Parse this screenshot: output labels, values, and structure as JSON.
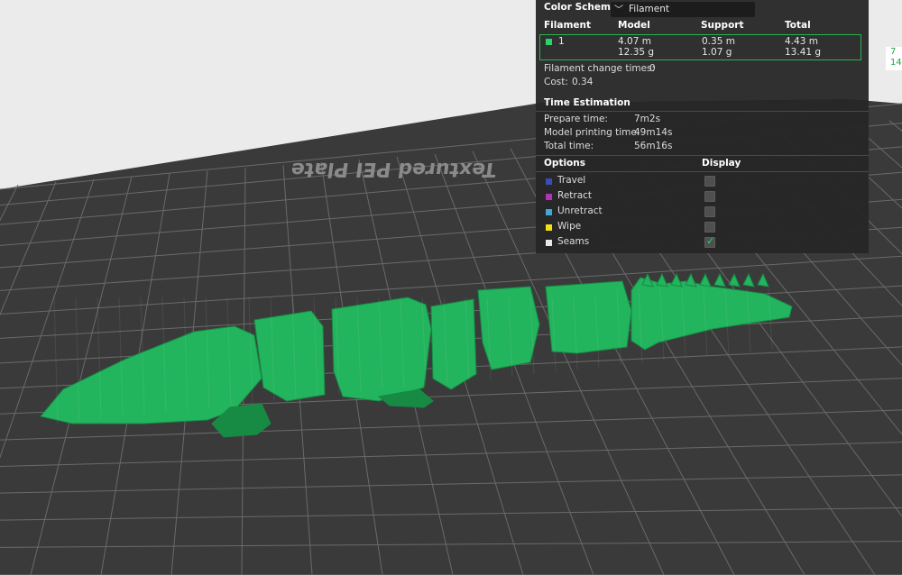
{
  "scene": {
    "plate_label": "Textured PEI Plate",
    "colors": {
      "background": "#ebebeb",
      "plate": "#3a3a3a",
      "grid": "#6a6a6a",
      "model": "#23b45e",
      "model_dark": "#178a44"
    }
  },
  "legend": {
    "color_scheme_label": "Color Scheme",
    "color_scheme_value": "Filament",
    "columns": {
      "filament": "Filament",
      "model": "Model",
      "support": "Support",
      "total": "Total"
    },
    "rows": [
      {
        "id": "1",
        "color": "#2bd46a",
        "model_length": "4.07 m",
        "model_weight": "12.35 g",
        "support_length": "0.35 m",
        "support_weight": "1.07 g",
        "total_length": "4.43 m",
        "total_weight": "13.41 g"
      }
    ],
    "change_times_label": "Filament change times:",
    "change_times_value": "0",
    "cost_label": "Cost:",
    "cost_value": "0.34",
    "time_estimation": {
      "title": "Time Estimation",
      "prepare_label": "Prepare time:",
      "prepare_value": "7m2s",
      "model_label": "Model printing time:",
      "model_value": "49m14s",
      "total_label": "Total time:",
      "total_value": "56m16s"
    },
    "options_header": "Options",
    "display_header": "Display",
    "options": [
      {
        "label": "Travel",
        "color": "#3a4eb2",
        "checked": false
      },
      {
        "label": "Retract",
        "color": "#b52fc1",
        "checked": false
      },
      {
        "label": "Unretract",
        "color": "#3fa8d6",
        "checked": false
      },
      {
        "label": "Wipe",
        "color": "#f2e017",
        "checked": false
      },
      {
        "label": "Seams",
        "color": "#e8e8e8",
        "checked": true
      }
    ]
  },
  "right_readout": {
    "line1": "7",
    "line2": "14"
  }
}
